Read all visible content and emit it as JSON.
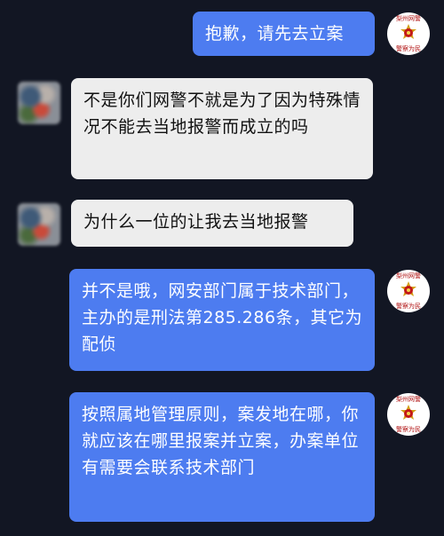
{
  "conversation": {
    "messages": [
      {
        "side": "out",
        "sender": "police",
        "text": "抱歉，请先去立案"
      },
      {
        "side": "in",
        "sender": "user",
        "text": "不是你们网警不就是为了因为特殊情况不能去当地报警而成立的吗"
      },
      {
        "side": "in",
        "sender": "user",
        "text": "为什么一位的让我去当地报警"
      },
      {
        "side": "out",
        "sender": "police",
        "text": "并不是哦，网安部门属于技术部门，主办的是刑法第285.286条，其它为配侦"
      },
      {
        "side": "out",
        "sender": "police",
        "text": "按照属地管理原则，案发地在哪，你就应该在哪里报案并立案，办案单位有需要会联系技术部门"
      }
    ]
  },
  "police_avatar": {
    "top_text": "梨州网警",
    "bottom_text": "警察为民",
    "icon": "police-badge-icon"
  },
  "user_avatar": {
    "icon": "blurred-user-avatar"
  },
  "colors": {
    "background": "#121623",
    "outgoing_bubble": "#4d7cf0",
    "incoming_bubble": "#ededed"
  }
}
